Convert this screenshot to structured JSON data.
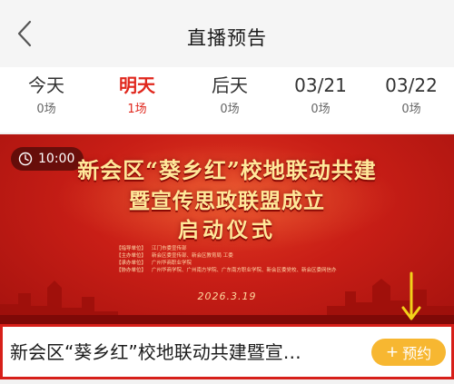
{
  "header": {
    "title": "直播预告",
    "back_icon": "chevron-left-icon"
  },
  "tabs": [
    {
      "label": "今天",
      "count": "0场",
      "active": false
    },
    {
      "label": "明天",
      "count": "1场",
      "active": true
    },
    {
      "label": "后天",
      "count": "0场",
      "active": false
    },
    {
      "label": "03/21",
      "count": "0场",
      "active": false
    },
    {
      "label": "03/22",
      "count": "0场",
      "active": false
    }
  ],
  "event": {
    "time": "10:00",
    "clock_icon": "clock-icon",
    "banner_line1": "新会区“葵乡红”校地联动共建",
    "banner_line2": "暨宣传思政联盟成立",
    "banner_line3": "启动仪式",
    "organizers": [
      {
        "role": "【指导单位】",
        "names": "江门市委宣传部"
      },
      {
        "role": "【主办单位】",
        "names": "新会区委宣传部、新会区教育局 工委"
      },
      {
        "role": "【承办单位】",
        "names": "广州华商职业学院"
      },
      {
        "role": "【协办单位】",
        "names": "广州华商学院、广州南方学院、广东南方职业学院、新会区委党校、新会区委网信办"
      }
    ],
    "date": "2026.3.19",
    "title": "新会区“葵乡红”校地联动共建暨宣…",
    "reserve_label": "预约",
    "reserve_icon": "plus-icon",
    "annotation_icon": "down-arrow-icon"
  },
  "colors": {
    "accent": "#e0271d",
    "reserve": "#f7b731",
    "highlight_border": "#d71f19",
    "annotation_arrow": "#f2d21a"
  }
}
